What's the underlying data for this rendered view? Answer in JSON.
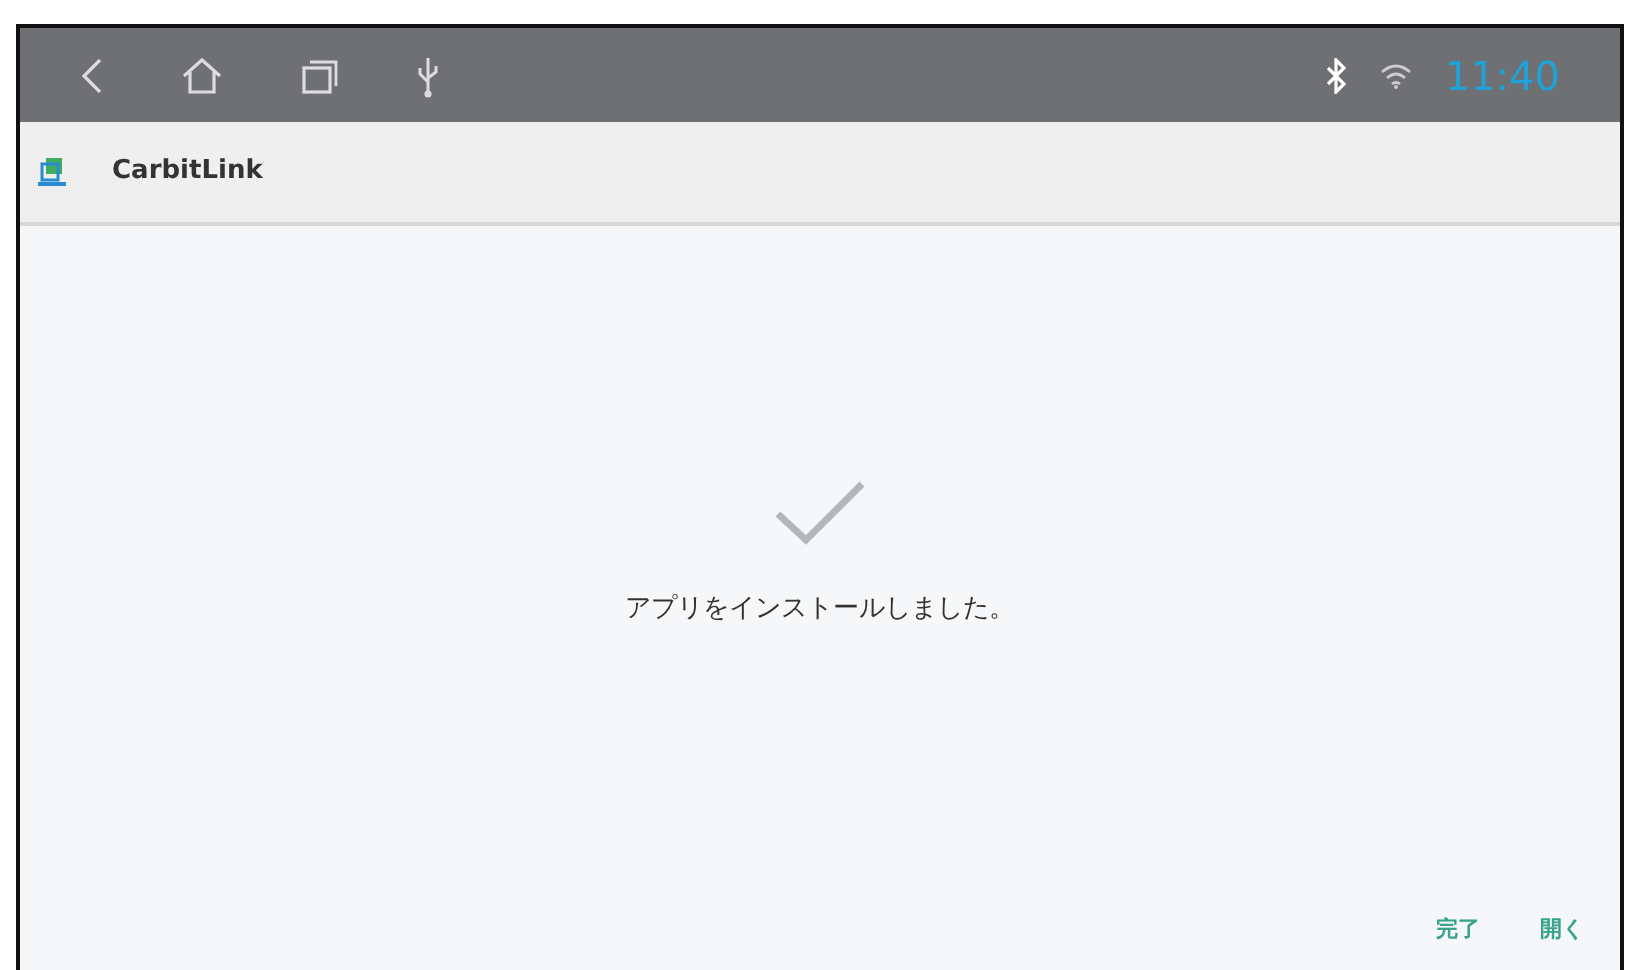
{
  "status_bar": {
    "time": "11:40"
  },
  "app_bar": {
    "title": "CarbitLink"
  },
  "message": "アプリをインストールしました。",
  "buttons": [
    {
      "label": "完了"
    },
    {
      "label": "開く"
    }
  ]
}
